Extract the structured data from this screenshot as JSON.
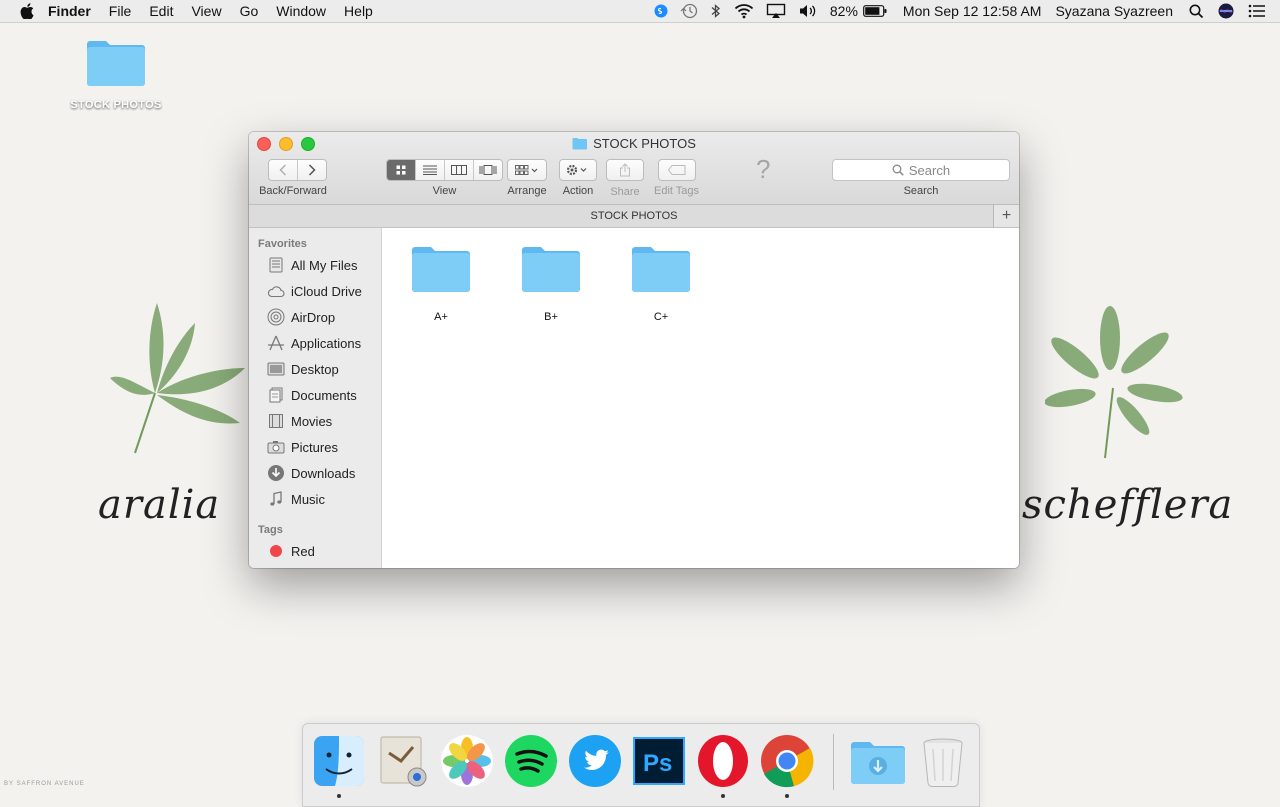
{
  "menubar": {
    "app": "Finder",
    "menus": [
      "File",
      "Edit",
      "View",
      "Go",
      "Window",
      "Help"
    ],
    "battery": "82%",
    "clock": "Mon Sep 12  12:58 AM",
    "user": "Syazana Syazreen"
  },
  "desktop": {
    "folder_label": "STOCK PHOTOS",
    "left_script": "aralia",
    "right_script": "schefflera",
    "credit": "BY SAFFRON AVENUE"
  },
  "window": {
    "title": "STOCK PHOTOS",
    "toolbar": {
      "back_forward": "Back/Forward",
      "view": "View",
      "arrange": "Arrange",
      "action": "Action",
      "share": "Share",
      "edit_tags": "Edit Tags",
      "search_placeholder": "Search",
      "search": "Search",
      "help": "?"
    },
    "path_title": "STOCK PHOTOS",
    "path_plus": "+",
    "sidebar": {
      "favorites_header": "Favorites",
      "items": [
        {
          "label": "All My Files",
          "icon": "all-files-icon"
        },
        {
          "label": "iCloud Drive",
          "icon": "cloud-icon"
        },
        {
          "label": "AirDrop",
          "icon": "airdrop-icon"
        },
        {
          "label": "Applications",
          "icon": "applications-icon"
        },
        {
          "label": "Desktop",
          "icon": "desktop-icon"
        },
        {
          "label": "Documents",
          "icon": "documents-icon"
        },
        {
          "label": "Movies",
          "icon": "movies-icon"
        },
        {
          "label": "Pictures",
          "icon": "pictures-icon"
        },
        {
          "label": "Downloads",
          "icon": "downloads-icon"
        },
        {
          "label": "Music",
          "icon": "music-icon"
        }
      ],
      "tags_header": "Tags",
      "tags": [
        {
          "label": "Red",
          "color": "#f0474a"
        }
      ]
    },
    "folders": [
      {
        "label": "A+"
      },
      {
        "label": "B+"
      },
      {
        "label": "C+"
      }
    ]
  },
  "dock": {
    "apps": [
      "Finder",
      "Mail",
      "Photos",
      "Spotify",
      "Twitter",
      "Photoshop",
      "Opera",
      "Chrome",
      "Downloads",
      "Trash"
    ]
  },
  "colors": {
    "folder_blue": "#6ec6f5",
    "accent": "#1e90ff"
  }
}
